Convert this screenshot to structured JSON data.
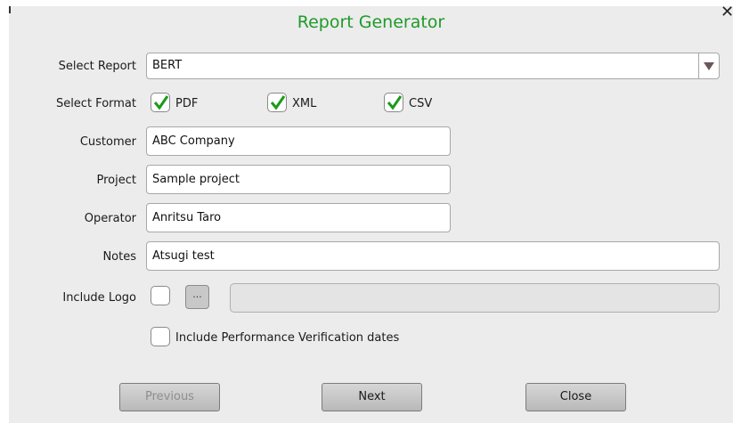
{
  "dialog": {
    "title": "Report Generator"
  },
  "select_report": {
    "label": "Select Report",
    "value": "BERT"
  },
  "select_format": {
    "label": "Select Format",
    "options": [
      {
        "label": "PDF",
        "checked": true
      },
      {
        "label": "XML",
        "checked": true
      },
      {
        "label": "CSV",
        "checked": true
      }
    ]
  },
  "customer": {
    "label": "Customer",
    "value": "ABC Company"
  },
  "project": {
    "label": "Project",
    "value": "Sample project"
  },
  "operator": {
    "label": "Operator",
    "value": "Anritsu Taro"
  },
  "notes": {
    "label": "Notes",
    "value": "Atsugi test"
  },
  "include_logo": {
    "label": "Include Logo",
    "checked": false,
    "browse_label": "...",
    "path": ""
  },
  "perf_verification": {
    "label": "Include Performance Verification dates",
    "checked": false
  },
  "buttons": {
    "previous": "Previous",
    "next": "Next",
    "close": "Close"
  },
  "colors": {
    "title": "#1f9a2a",
    "check": "#1a9a1a",
    "background": "#ececec"
  }
}
